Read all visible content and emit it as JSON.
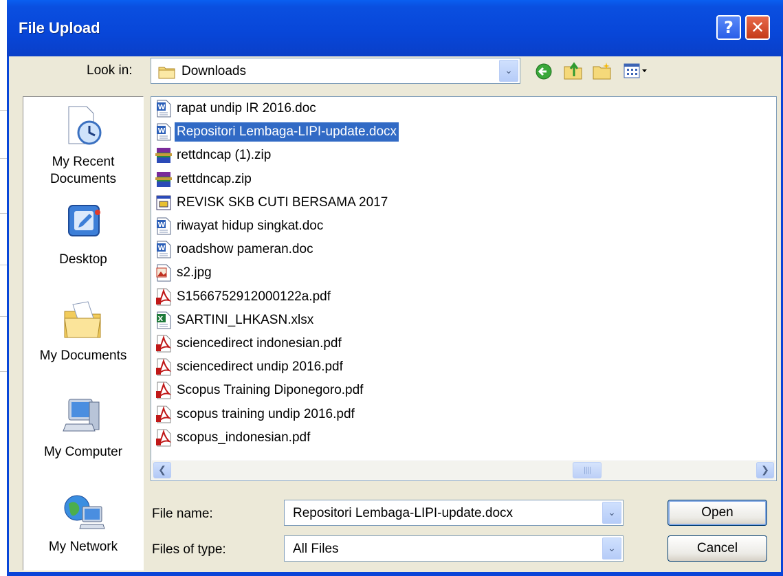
{
  "window": {
    "title": "File Upload",
    "help_glyph": "?",
    "close_glyph": "✕"
  },
  "toolbar": {
    "look_in_label": "Look in:",
    "look_in_value": "Downloads",
    "icons": [
      "back-icon",
      "up-folder-icon",
      "new-folder-icon",
      "view-menu-icon"
    ]
  },
  "places": [
    {
      "label_line1": "My Recent",
      "label_line2": "Documents",
      "icon": "recent-documents-icon"
    },
    {
      "label_line1": "Desktop",
      "label_line2": "",
      "icon": "desktop-icon"
    },
    {
      "label_line1": "My Documents",
      "label_line2": "",
      "icon": "my-documents-icon"
    },
    {
      "label_line1": "My Computer",
      "label_line2": "",
      "icon": "my-computer-icon"
    },
    {
      "label_line1": "My Network",
      "label_line2": "",
      "icon": "my-network-icon"
    }
  ],
  "files": [
    {
      "name": "rapat undip IR 2016.doc",
      "type": "word"
    },
    {
      "name": "Repositori Lembaga-LIPI-update.docx",
      "type": "word",
      "selected": true
    },
    {
      "name": "rettdncap (1).zip",
      "type": "zip"
    },
    {
      "name": "rettdncap.zip",
      "type": "zip"
    },
    {
      "name": "REVISK SKB CUTI BERSAMA 2017",
      "type": "app"
    },
    {
      "name": "riwayat hidup singkat.doc",
      "type": "word"
    },
    {
      "name": "roadshow pameran.doc",
      "type": "word"
    },
    {
      "name": "s2.jpg",
      "type": "image"
    },
    {
      "name": "S1566752912000122a.pdf",
      "type": "pdf"
    },
    {
      "name": "SARTINI_LHKASN.xlsx",
      "type": "excel"
    },
    {
      "name": "sciencedirect indonesian.pdf",
      "type": "pdf"
    },
    {
      "name": "sciencedirect undip 2016.pdf",
      "type": "pdf"
    },
    {
      "name": "Scopus Training Diponegoro.pdf",
      "type": "pdf"
    },
    {
      "name": "scopus training undip 2016.pdf",
      "type": "pdf"
    },
    {
      "name": "scopus_indonesian.pdf",
      "type": "pdf"
    }
  ],
  "form": {
    "file_name_label": "File name:",
    "file_name_value": "Repositori Lembaga-LIPI-update.docx",
    "file_type_label": "Files of type:",
    "file_type_value": "All Files"
  },
  "buttons": {
    "open_label": "Open",
    "cancel_label": "Cancel"
  }
}
